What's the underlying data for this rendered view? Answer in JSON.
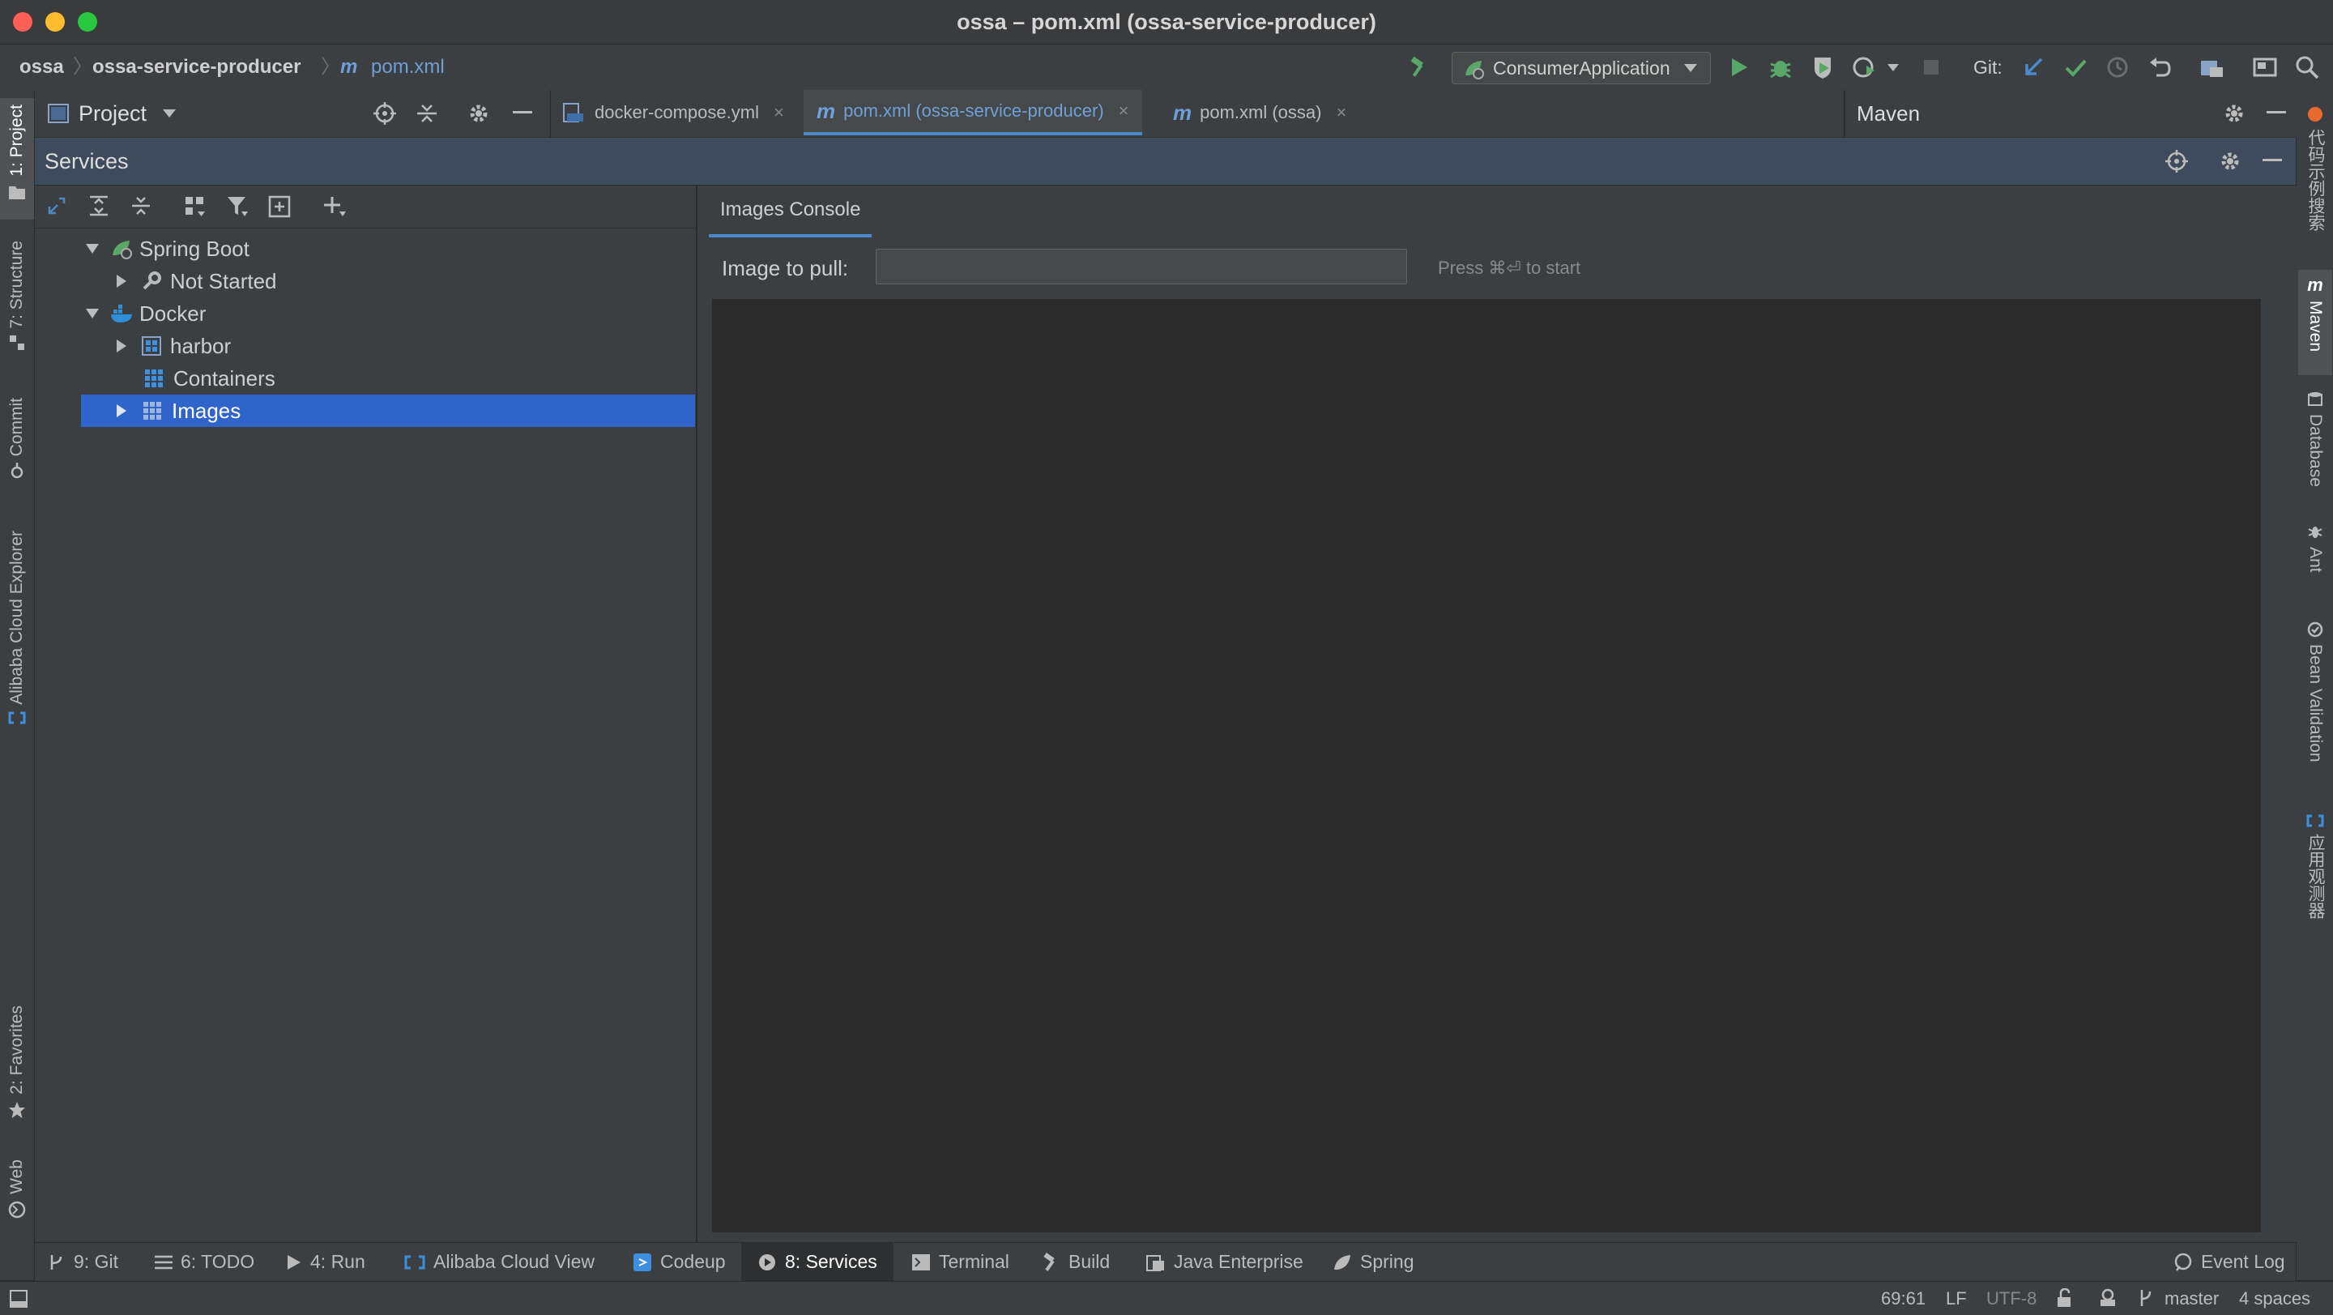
{
  "window": {
    "title": "ossa – pom.xml (ossa-service-producer)"
  },
  "breadcrumb": {
    "project": "ossa",
    "module": "ossa-service-producer",
    "file": "pom.xml"
  },
  "toolbar": {
    "run_config": "ConsumerApplication",
    "git_label": "Git:"
  },
  "left_stripe": {
    "tabs": [
      "1: Project",
      "7: Structure",
      "Commit",
      "Alibaba Cloud Explorer",
      "2: Favorites",
      "Web"
    ]
  },
  "right_stripe": {
    "tabs": [
      "代码示例搜索",
      "Maven",
      "Database",
      "Ant",
      "Bean Validation",
      "应用观测器"
    ]
  },
  "project_panel": {
    "title": "Project"
  },
  "editor_tabs": [
    {
      "label": "docker-compose.yml",
      "icon": "docker-compose-file-icon",
      "active": false
    },
    {
      "label": "pom.xml (ossa-service-producer)",
      "icon": "maven-file-icon",
      "active": true
    },
    {
      "label": "pom.xml (ossa)",
      "icon": "maven-file-icon",
      "active": false
    }
  ],
  "maven_panel": {
    "title": "Maven"
  },
  "services": {
    "title": "Services",
    "tree": [
      {
        "label": "Spring Boot",
        "level": 0,
        "expanded": true,
        "icon": "spring-boot-icon"
      },
      {
        "label": "Not Started",
        "level": 1,
        "expanded": false,
        "icon": "wrench-icon"
      },
      {
        "label": "Docker",
        "level": 0,
        "expanded": true,
        "icon": "docker-icon"
      },
      {
        "label": "harbor",
        "level": 1,
        "expanded": false,
        "icon": "docker-compose-icon"
      },
      {
        "label": "Containers",
        "level": 1,
        "expanded": null,
        "icon": "containers-icon"
      },
      {
        "label": "Images",
        "level": 1,
        "expanded": false,
        "icon": "images-icon",
        "selected": true
      }
    ]
  },
  "console": {
    "tab_label": "Images Console",
    "pull_label": "Image to pull:",
    "pull_value": "",
    "hint": "Press ⌘⏎ to start"
  },
  "bottom_tabs": [
    {
      "label": "9: Git",
      "icon": "git-branch-icon"
    },
    {
      "label": "6: TODO",
      "icon": "list-icon"
    },
    {
      "label": "4: Run",
      "icon": "run-icon"
    },
    {
      "label": "Alibaba Cloud View",
      "icon": "alibaba-cloud-icon"
    },
    {
      "label": "Codeup",
      "icon": "codeup-icon"
    },
    {
      "label": "8: Services",
      "icon": "services-icon",
      "active": true
    },
    {
      "label": "Terminal",
      "icon": "terminal-icon"
    },
    {
      "label": "Build",
      "icon": "hammer-icon"
    },
    {
      "label": "Java Enterprise",
      "icon": "java-enterprise-icon"
    },
    {
      "label": "Spring",
      "icon": "spring-leaf-icon"
    }
  ],
  "event_log": "Event Log",
  "status": {
    "position": "69:61",
    "line_ending": "LF",
    "encoding": "UTF-8",
    "branch": "master",
    "indent": "4 spaces"
  },
  "colors": {
    "accent": "#4a88c7",
    "selection": "#2f65ca",
    "services_bar": "#3d4b5c",
    "run_green": "#59a869"
  }
}
